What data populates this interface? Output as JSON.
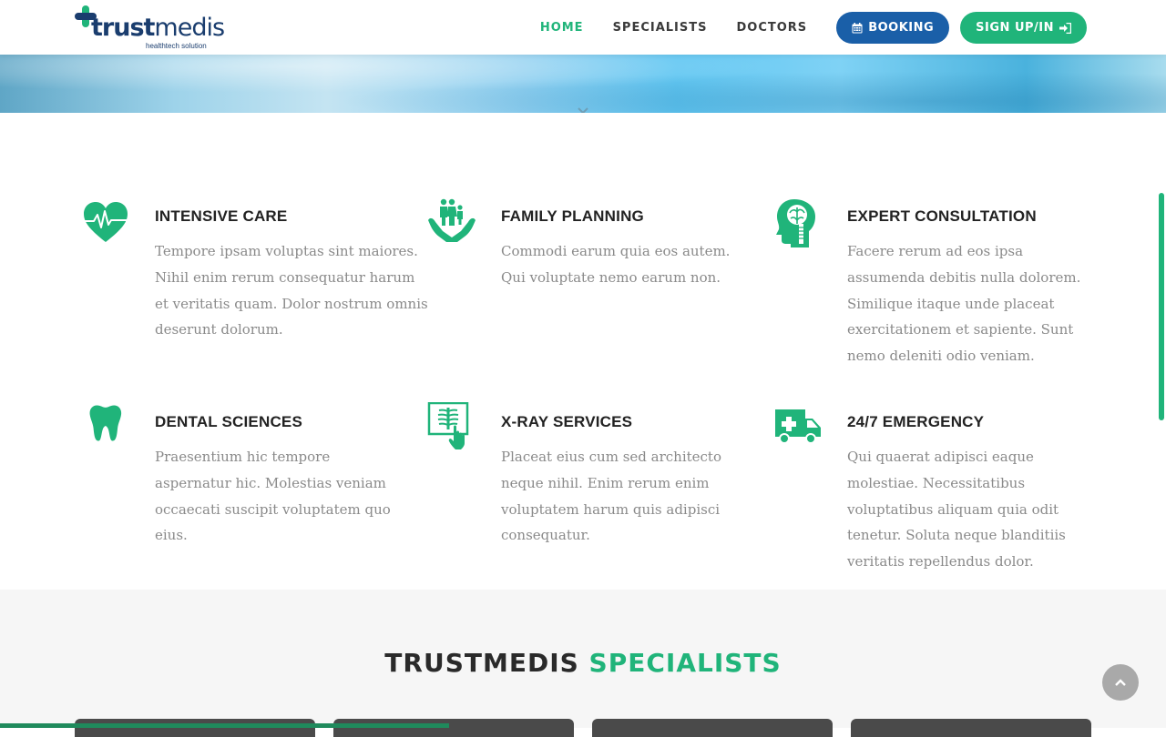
{
  "header": {
    "logo": {
      "brand": "trustmedis",
      "brand_part1": "trust",
      "brand_part2": "medis",
      "tagline": "healthtech solution"
    },
    "nav": [
      {
        "label": "HOME",
        "active": true
      },
      {
        "label": "SPECIALISTS",
        "active": false
      },
      {
        "label": "DOCTORS",
        "active": false
      }
    ],
    "booking_label": "BOOKING",
    "booking_icon": "calendar-icon",
    "sign_label": "SIGN UP/IN",
    "sign_icon": "sign-in-icon"
  },
  "services": [
    {
      "title": "INTENSIVE CARE",
      "icon": "heartbeat-icon",
      "text": "Tempore ipsam voluptas sint maiores. Nihil enim rerum consequatur harum et veritatis quam. Dolor nostrum omnis deserunt dolorum."
    },
    {
      "title": "FAMILY PLANNING",
      "icon": "family-hands-icon",
      "text": "Commodi earum quia eos autem. Qui voluptate nemo earum non."
    },
    {
      "title": "EXPERT CONSULTATION",
      "icon": "brain-head-icon",
      "text": "Facere rerum ad eos ipsa assumenda debitis nulla dolorem. Similique itaque unde placeat exercitationem et sapiente. Sunt nemo deleniti odio veniam."
    },
    {
      "title": "DENTAL SCIENCES",
      "icon": "tooth-icon",
      "text": "Praesentium hic tempore aspernatur hic. Molestias veniam occaecati suscipit voluptatem quo eius."
    },
    {
      "title": "X-RAY SERVICES",
      "icon": "xray-icon",
      "text": "Placeat eius cum sed architecto neque nihil. Enim rerum enim voluptatem harum quis adipisci consequatur."
    },
    {
      "title": "24/7 EMERGENCY",
      "icon": "ambulance-icon",
      "text": "Qui quaerat adipisci eaque molestiae. Necessitatibus voluptatibus aliquam quia odit tenetur. Soluta neque blanditiis veritatis repellendus dolor."
    }
  ],
  "specialists": {
    "title_part1": "TRUSTMEDIS",
    "title_part2": "SPECIALISTS"
  },
  "colors": {
    "accent": "#20b47a",
    "primary": "#1a5fa8",
    "brand_dark": "#1a3d6e"
  }
}
